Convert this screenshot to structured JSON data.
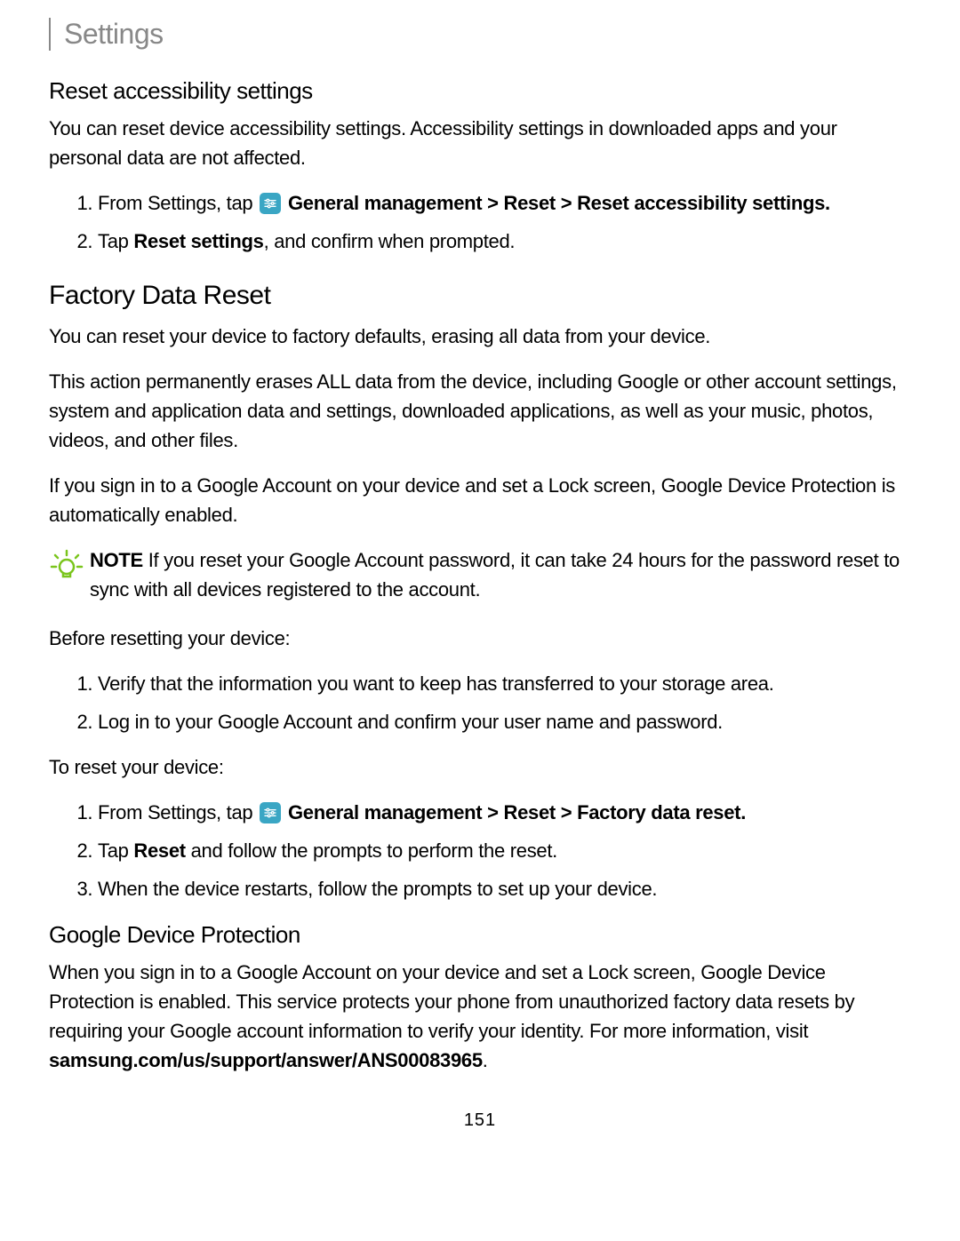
{
  "header": "Settings",
  "section1": {
    "title": "Reset accessibility settings",
    "para1": "You can reset device accessibility settings. Accessibility settings in downloaded apps and your personal data are not affected.",
    "step1_pre": "From Settings, tap ",
    "step1_path": "General management > Reset > Reset accessibility settings.",
    "step2_pre": "Tap ",
    "step2_bold": "Reset settings",
    "step2_post": ", and confirm when prompted."
  },
  "section2": {
    "title": "Factory Data Reset",
    "para1": "You can reset your device to factory defaults, erasing all data from your device.",
    "para2": "This action permanently erases ALL data from the device, including Google or other account settings, system and application data and settings, downloaded applications, as well as your music, photos, videos, and other files.",
    "para3": "If you sign in to a Google Account on your device and set a Lock screen, Google Device Protection is automatically enabled."
  },
  "note": {
    "label": "NOTE",
    "text": "  If you reset your Google Account password, it can take 24 hours for the password reset to sync with all devices registered to the account."
  },
  "before": {
    "intro": "Before resetting your device:",
    "step1": "Verify that the information you want to keep has transferred to your storage area.",
    "step2": "Log in to your Google Account and confirm your user name and password."
  },
  "reset": {
    "intro": "To reset your device:",
    "step1_pre": "From Settings, tap ",
    "step1_path": "General management > Reset > Factory data reset.",
    "step2_pre": "Tap ",
    "step2_bold": "Reset",
    "step2_post": " and follow the prompts to perform the reset.",
    "step3": "When the device restarts, follow the prompts to set up your device."
  },
  "gdp": {
    "title": "Google Device Protection",
    "para_pre": "When you sign in to a Google Account on your device and set a Lock screen, Google Device Protection is enabled. This service protects your phone from unauthorized factory data resets by requiring your Google account information to verify your identity. For more information, visit ",
    "link": "samsung.com/us/support/answer/ANS00083965",
    "para_post": "."
  },
  "pagenum": "151"
}
